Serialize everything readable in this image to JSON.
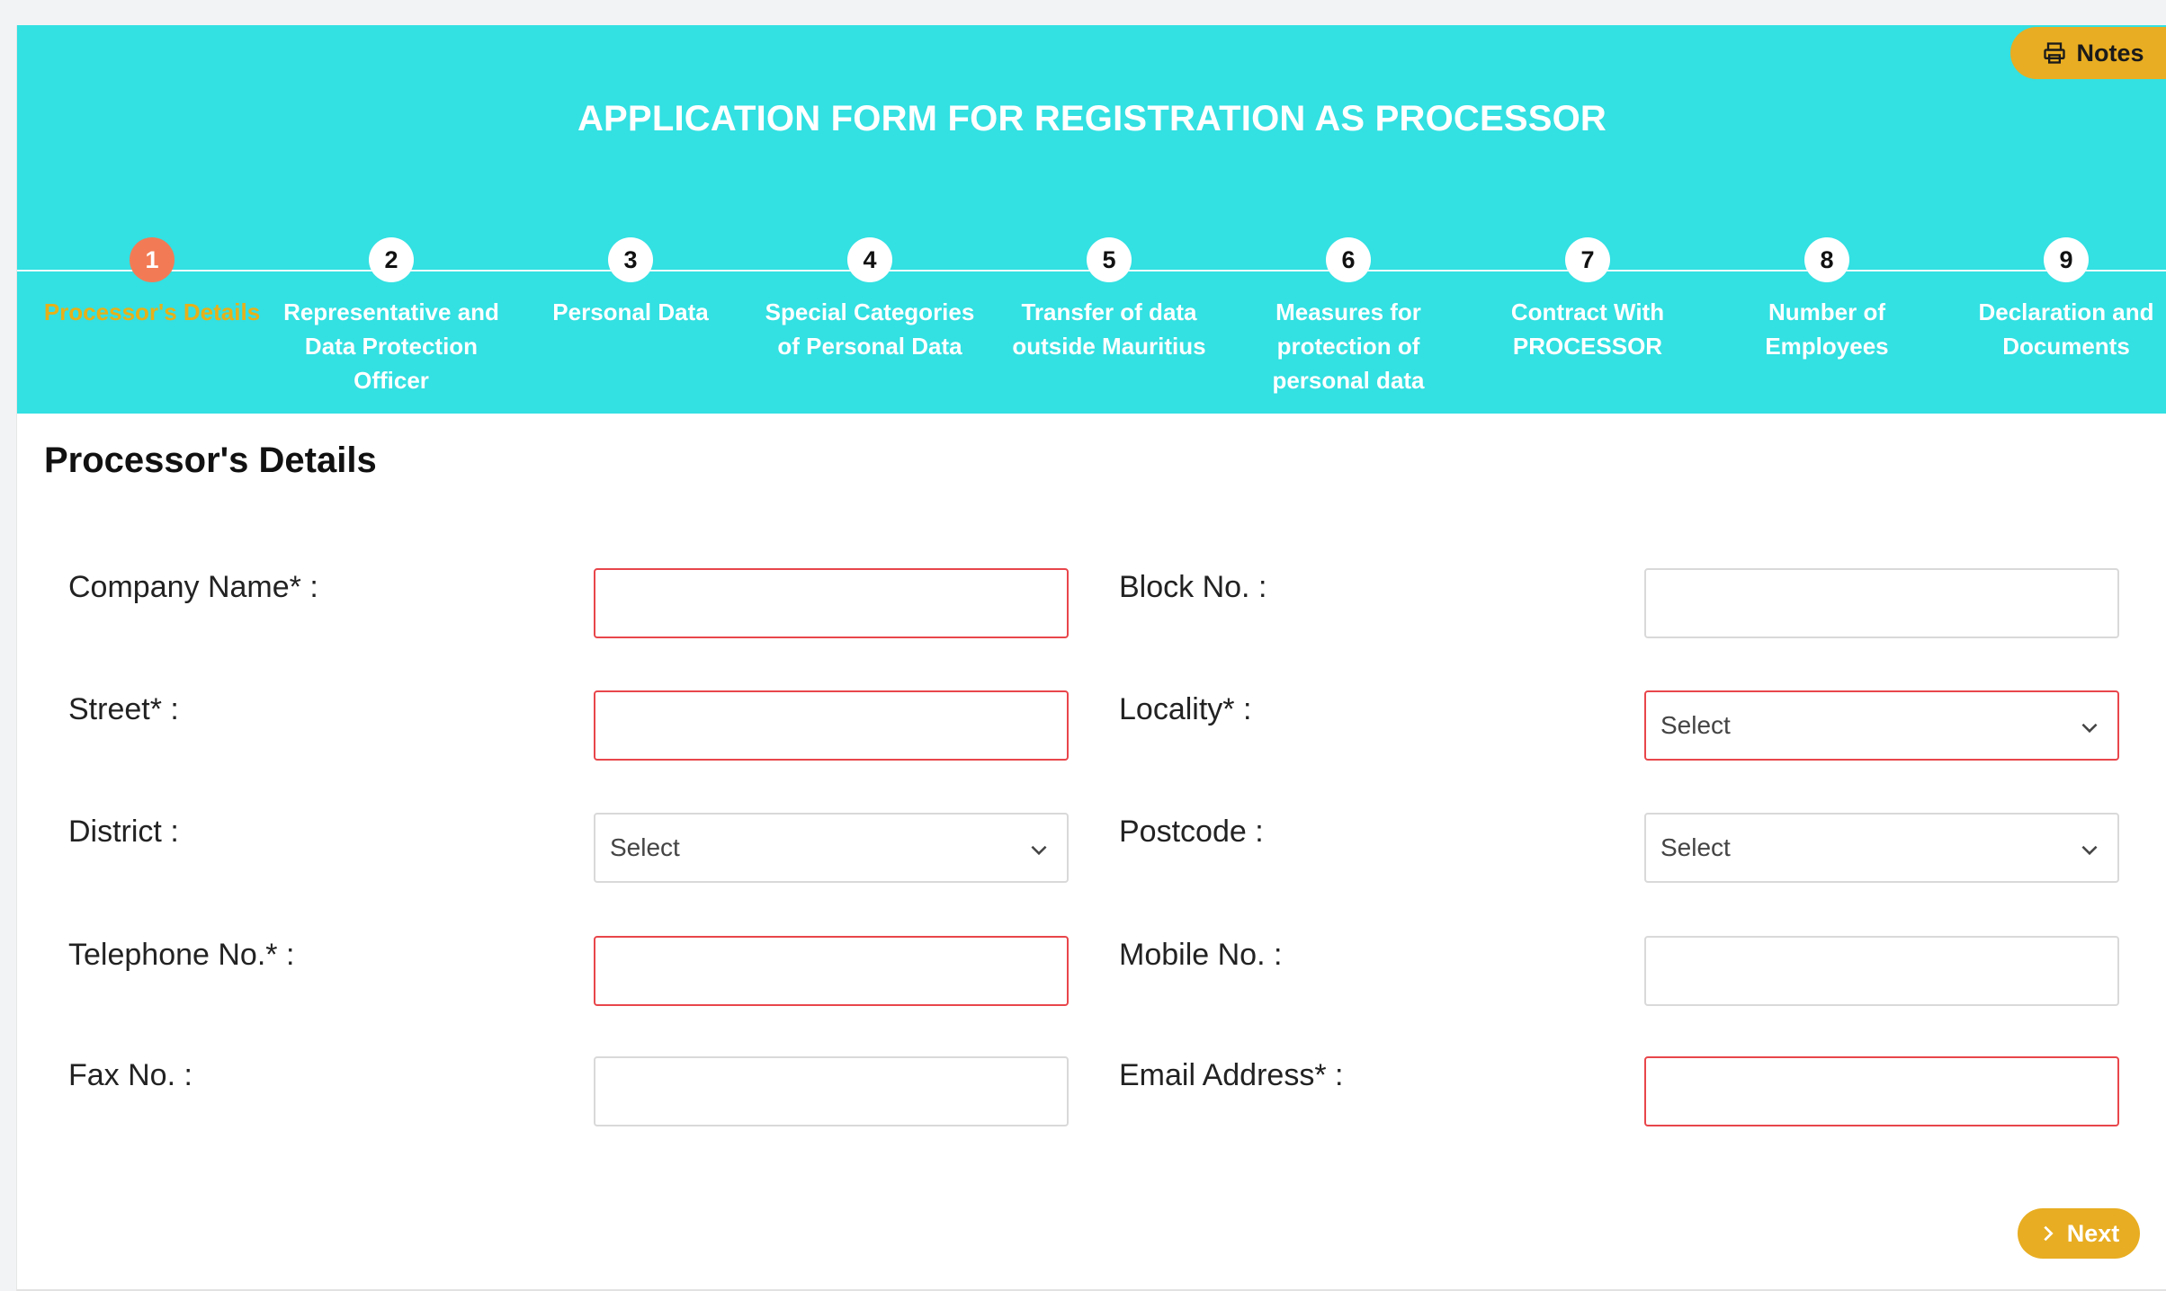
{
  "header": {
    "title": "APPLICATION FORM FOR REGISTRATION AS PROCESSOR",
    "notes_label": "Notes"
  },
  "steps": [
    {
      "num": "1",
      "label": "Processor's Details",
      "active": true
    },
    {
      "num": "2",
      "label": "Representative and Data Protection Officer"
    },
    {
      "num": "3",
      "label": "Personal Data"
    },
    {
      "num": "4",
      "label": "Special Categories of Personal Data"
    },
    {
      "num": "5",
      "label": "Transfer of data outside Mauritius"
    },
    {
      "num": "6",
      "label": "Measures for protection of personal data"
    },
    {
      "num": "7",
      "label": "Contract With PROCESSOR"
    },
    {
      "num": "8",
      "label": "Number of Employees"
    },
    {
      "num": "9",
      "label": "Declaration and Documents"
    }
  ],
  "section": {
    "title": "Processor's Details"
  },
  "form": {
    "company_name": {
      "label": "Company Name* :",
      "value": ""
    },
    "block_no": {
      "label": "Block No. :",
      "value": ""
    },
    "street": {
      "label": "Street* :",
      "value": ""
    },
    "locality": {
      "label": "Locality* :",
      "selected": "Select"
    },
    "district": {
      "label": "District :",
      "selected": "Select"
    },
    "postcode": {
      "label": "Postcode :",
      "selected": "Select"
    },
    "telephone": {
      "label": "Telephone No.* :",
      "value": ""
    },
    "mobile": {
      "label": "Mobile No. :",
      "value": ""
    },
    "fax": {
      "label": "Fax No. :",
      "value": ""
    },
    "email": {
      "label": "Email Address* :",
      "value": ""
    }
  },
  "footer": {
    "next_label": "Next"
  },
  "colors": {
    "header_bg": "#33e0e2",
    "accent": "#e8ad22",
    "active_step": "#f27b55",
    "required_border": "#e8464b"
  },
  "icons": {
    "notes": "printer-icon",
    "next": "chevron-right-icon",
    "select": "chevron-down-icon"
  }
}
